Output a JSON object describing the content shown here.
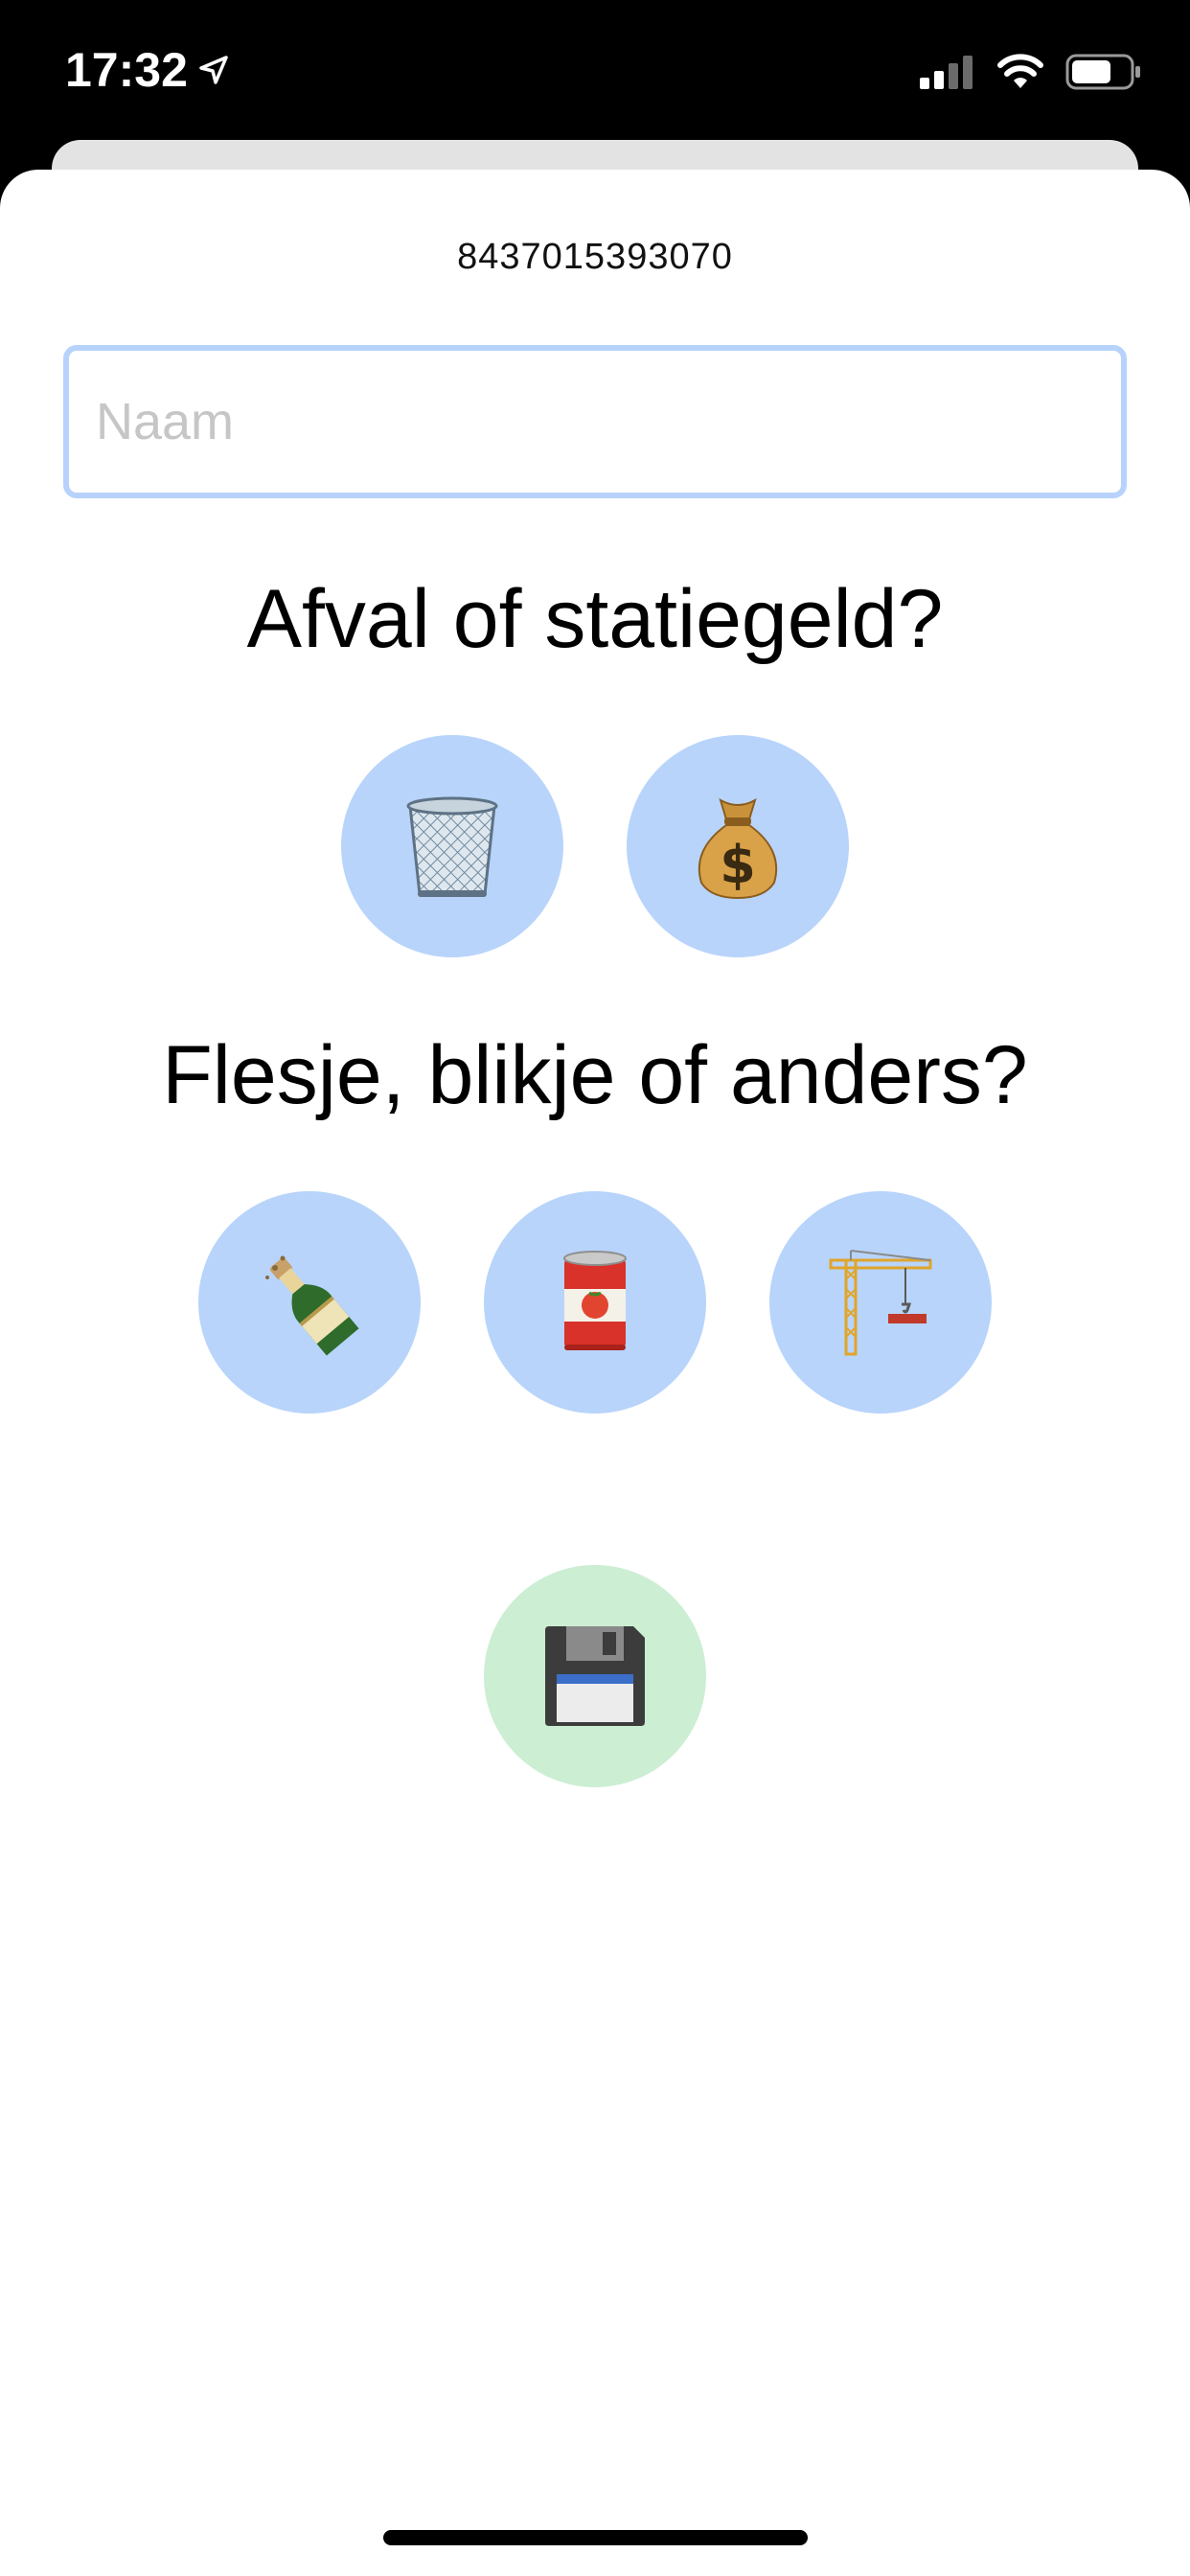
{
  "status_bar": {
    "time": "17:32",
    "icons": [
      "location-arrow-icon",
      "cellular-signal-icon",
      "wifi-icon",
      "battery-icon"
    ]
  },
  "sheet": {
    "barcode": "8437015393070",
    "name_input": {
      "value": "",
      "placeholder": "Naam"
    },
    "question_type": "Afval of statiegeld?",
    "type_options": [
      {
        "name": "trash",
        "icon": "wastebasket-icon"
      },
      {
        "name": "deposit",
        "icon": "money-bag-icon"
      }
    ],
    "question_container": "Flesje, blikje of anders?",
    "container_options": [
      {
        "name": "bottle",
        "icon": "bottle-icon"
      },
      {
        "name": "can",
        "icon": "canned-food-icon"
      },
      {
        "name": "other",
        "icon": "construction-crane-icon"
      }
    ],
    "save_button": {
      "icon": "floppy-disk-icon"
    }
  },
  "colors": {
    "option_circle": "#b8d4fb",
    "save_circle": "#cceed3",
    "input_border": "#b7d3fb",
    "placeholder": "#c6c6c8"
  }
}
